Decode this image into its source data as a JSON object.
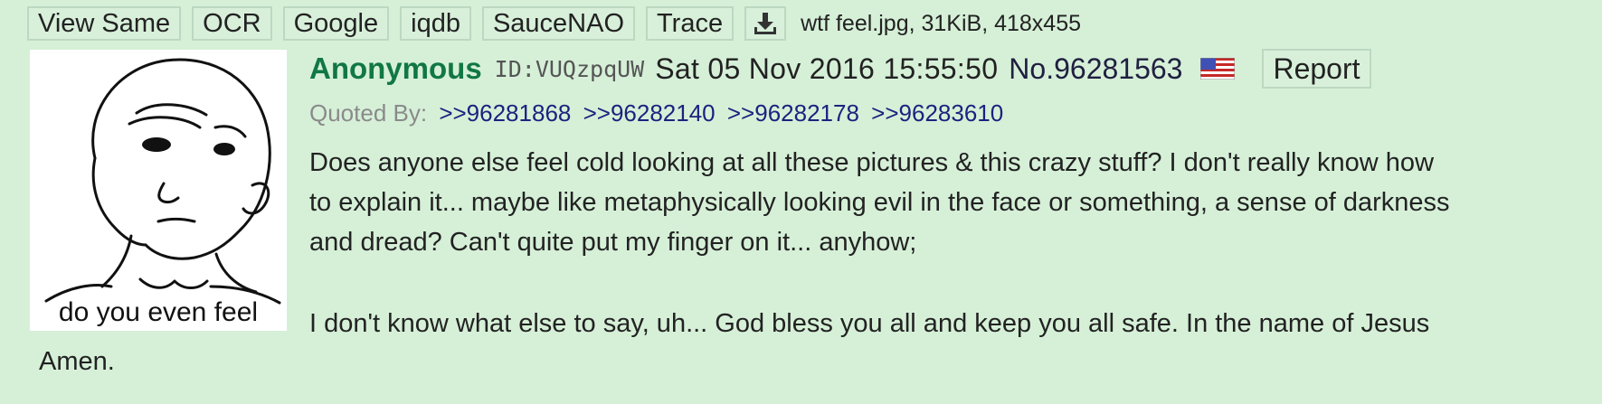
{
  "file": {
    "tools": [
      "View Same",
      "OCR",
      "Google",
      "iqdb",
      "SauceNAO",
      "Trace"
    ],
    "download_icon": "download-icon",
    "info": "wtf feel.jpg, 31KiB, 418x455"
  },
  "thumbnail": {
    "caption": "do you even feel"
  },
  "post": {
    "name": "Anonymous",
    "id": "ID:VUQzpqUW",
    "date": "Sat 05 Nov 2016 15:55:50",
    "number": "No.96281563",
    "flag_icon": "us-flag-icon",
    "report_label": "Report",
    "quoted_by_label": "Quoted By:",
    "quoted_by": [
      ">>96281868",
      ">>96282140",
      ">>96282178",
      ">>96283610"
    ],
    "body_lines": [
      "Does anyone else feel cold looking at all these pictures & this crazy stuff? I don't really know how",
      "to explain it... maybe like metaphysically looking evil in the face or something, a sense of darkness",
      "and dread? Can't quite put my finger on it... anyhow;",
      "I don't know what else to say, uh... God bless you all and keep you all safe. In the name of Jesus",
      "Amen."
    ]
  },
  "colors": {
    "background": "#d6f0d8",
    "name": "#117743",
    "quote_link": "#1a237e"
  }
}
